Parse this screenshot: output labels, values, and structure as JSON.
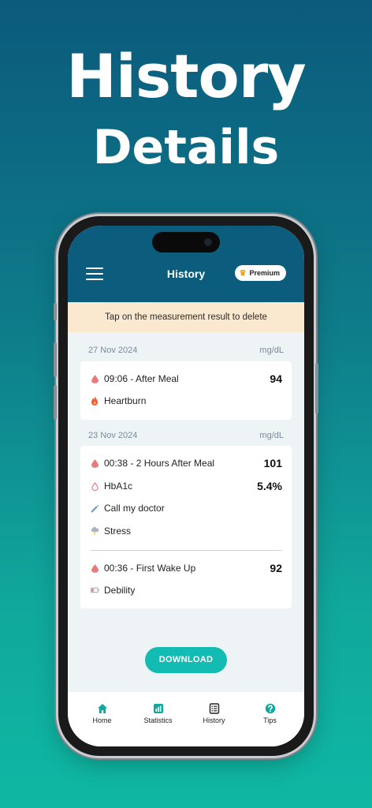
{
  "hero": {
    "line1": "History",
    "line2": "Details"
  },
  "appbar": {
    "title": "History",
    "premium_label": "Premium"
  },
  "banner": "Tap on the measurement result to delete",
  "groups": [
    {
      "date": "27 Nov 2024",
      "unit": "mg/dL",
      "entries": [
        {
          "label": "09:06 - After Meal",
          "value": "94",
          "icon": "blood-drop-icon"
        },
        {
          "label": "Heartburn",
          "value": "",
          "icon": "fire-icon"
        }
      ]
    },
    {
      "date": "23 Nov 2024",
      "unit": "mg/dL",
      "entries": [
        {
          "label": "00:38 - 2 Hours After Meal",
          "value": "101",
          "icon": "blood-drop-icon"
        },
        {
          "label": "HbA1c",
          "value": "5.4%",
          "icon": "drop-outline-icon"
        },
        {
          "label": "Call my doctor",
          "value": "",
          "icon": "syringe-icon"
        },
        {
          "label": "Stress",
          "value": "",
          "icon": "storm-cloud-icon"
        },
        {
          "label": "00:36 - First Wake Up",
          "value": "92",
          "icon": "blood-drop-icon"
        },
        {
          "label": "Debility",
          "value": "",
          "icon": "low-battery-icon"
        }
      ]
    }
  ],
  "download_label": "DOWNLOAD",
  "nav": [
    {
      "label": "Home",
      "icon": "home-icon"
    },
    {
      "label": "Statistics",
      "icon": "statistics-icon"
    },
    {
      "label": "History",
      "icon": "history-icon"
    },
    {
      "label": "Tips",
      "icon": "help-icon"
    }
  ],
  "colors": {
    "appbar": "#0c5d7d",
    "accent": "#13bcb2",
    "banner": "#fbe9cf",
    "drop": "#e67b7b"
  }
}
